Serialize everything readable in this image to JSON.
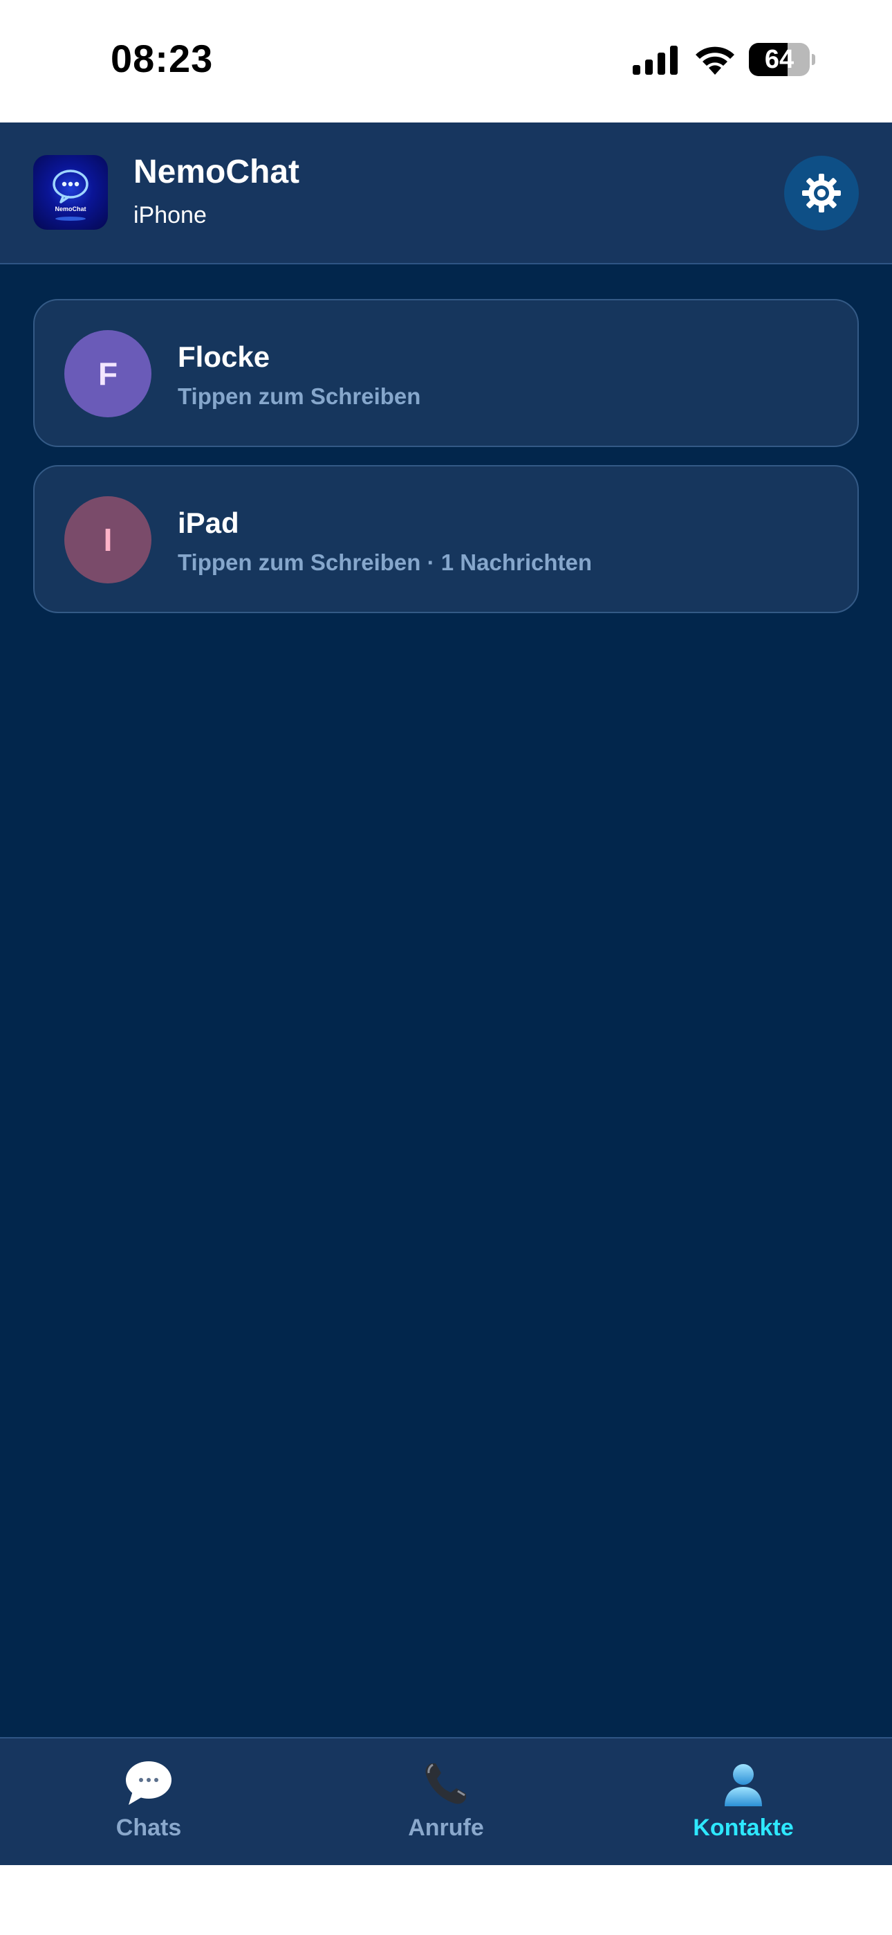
{
  "status_bar": {
    "time": "08:23",
    "battery_level": "64",
    "battery_fraction": 0.64
  },
  "header": {
    "title": "NemoChat",
    "subtitle": "iPhone",
    "logo_text": "NemoChat",
    "icons": {
      "logo": "chat-bubble-logo-icon",
      "settings": "gear-icon"
    }
  },
  "contacts": [
    {
      "initial": "F",
      "name": "Flocke",
      "subtitle": "Tippen zum Schreiben",
      "avatar_color": "#6a5bb8",
      "initial_color": "#f3e6ff"
    },
    {
      "initial": "I",
      "name": "iPad",
      "subtitle": "Tippen zum Schreiben · 1 Nachrichten",
      "avatar_color": "#7a4b6a",
      "initial_color": "#ffb3c8"
    }
  ],
  "tabs": [
    {
      "label": "Chats",
      "icon": "speech-bubble-icon",
      "active": false
    },
    {
      "label": "Anrufe",
      "icon": "phone-icon",
      "active": false
    },
    {
      "label": "Kontakte",
      "icon": "person-icon",
      "active": true
    }
  ],
  "colors": {
    "header_bg": "#17365f",
    "main_bg": "#02264c",
    "card_bg": "#16365d",
    "accent_active": "#2ee8ff",
    "inactive_label": "#8aa8cc",
    "subtitle_text": "#86a7cc"
  }
}
